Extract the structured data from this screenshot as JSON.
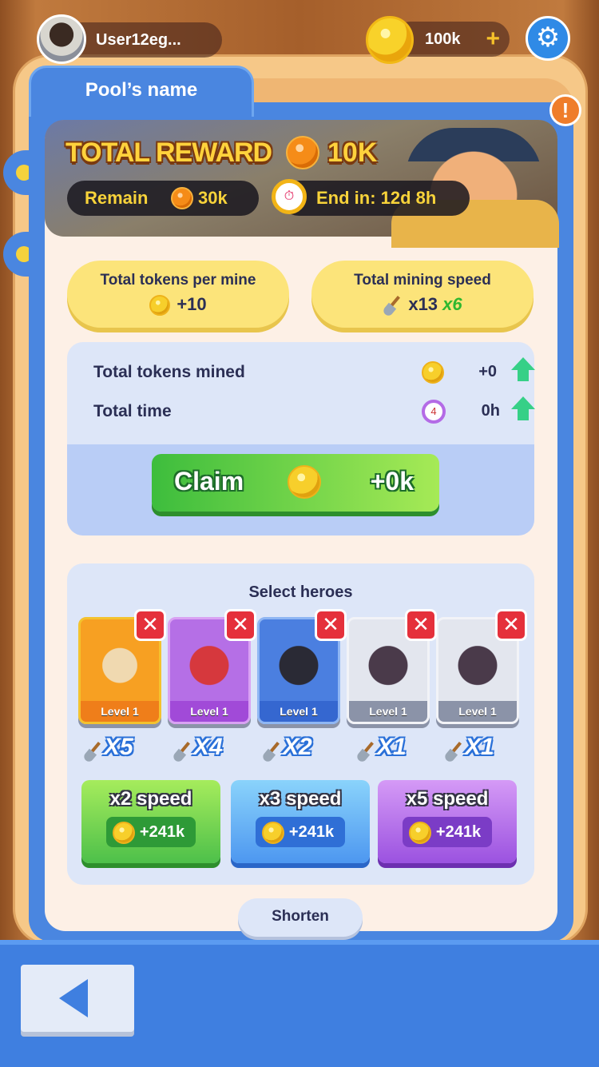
{
  "user": {
    "name": "User12eg..."
  },
  "balance": {
    "amount": "100k",
    "plus": "+"
  },
  "pool": {
    "name": "Pool’s name"
  },
  "warning": {
    "symbol": "!"
  },
  "banner": {
    "title": "TOTAL REWARD",
    "reward": "10K",
    "remain_label": "Remain",
    "remain_value": "30k",
    "end_label": "End in: 12d 8h"
  },
  "stats": {
    "tokens_per_mine_label": "Total tokens per mine",
    "tokens_per_mine_value": "+10",
    "mining_speed_label": "Total mining speed",
    "mining_speed_value": "x13",
    "mining_speed_bonus": "x6"
  },
  "mined": {
    "tokens_label": "Total tokens mined",
    "tokens_value": "+0",
    "time_label": "Total time",
    "time_value": "0h"
  },
  "claim": {
    "label": "Claim",
    "value": "+0k"
  },
  "heroes": {
    "title": "Select heroes",
    "close_symbol": "✕",
    "items": [
      {
        "level": "Level 1",
        "multiplier": "X5"
      },
      {
        "level": "Level 1",
        "multiplier": "X4"
      },
      {
        "level": "Level 1",
        "multiplier": "X2"
      },
      {
        "level": "Level 1",
        "multiplier": "X1"
      },
      {
        "level": "Level 1",
        "multiplier": "X1"
      }
    ]
  },
  "boosts": [
    {
      "label": "x2 speed",
      "cost": "+241k"
    },
    {
      "label": "x3 speed",
      "cost": "+241k"
    },
    {
      "label": "x5 speed",
      "cost": "+241k"
    }
  ],
  "shorten": {
    "label": "Shorten"
  },
  "colors": {
    "accent_blue": "#4a86e0",
    "claim_green": "#3dbd3d",
    "bonus_green": "#2fb82f"
  }
}
